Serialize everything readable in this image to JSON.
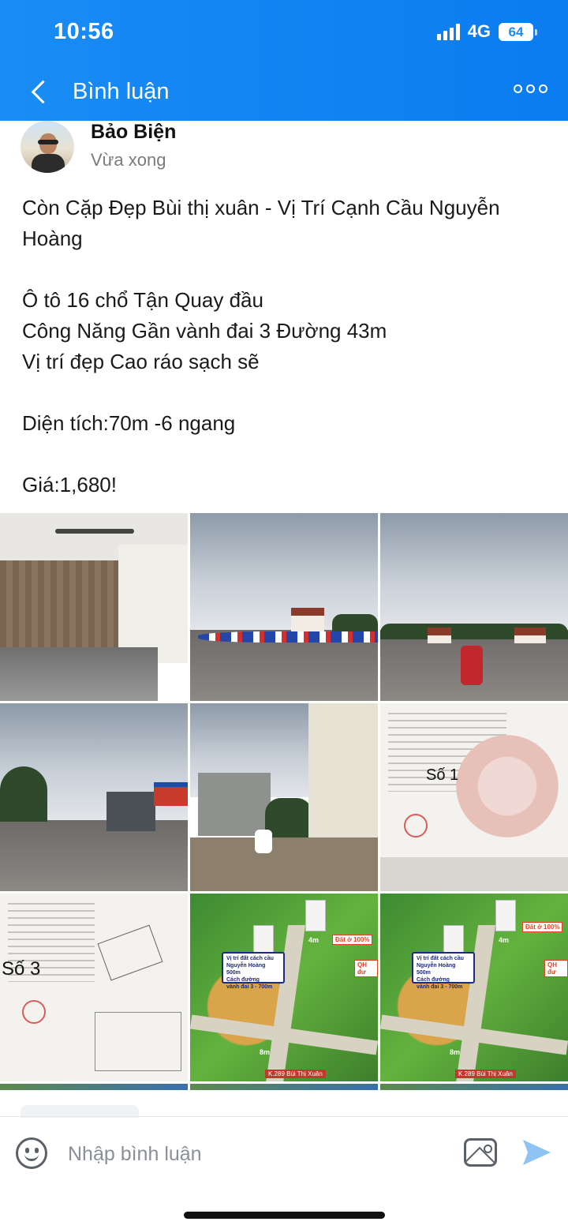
{
  "status_bar": {
    "time": "10:56",
    "network": "4G",
    "battery": "64"
  },
  "header": {
    "title": "Bình luận",
    "back_icon": "chevron-left-icon",
    "more_icon": "more-dots-icon"
  },
  "post": {
    "author": "Bảo Biện",
    "time": "Vừa xong",
    "text_lines": [
      "Còn Cặp Đẹp Bùi thị xuân - Vị Trí Cạnh Cầu Nguyễn",
      "Hoàng",
      "",
      "Ô tô 16 chổ Tận Quay đầu",
      "Công Năng Gần vành đai 3 Đường 43m",
      "Vị trí đẹp Cao ráo sạch sẽ",
      "",
      "Diện tích:70m -6 ngang",
      "",
      "Giá:1,680!"
    ],
    "image_labels": {
      "doc1": "Số 1",
      "doc3": "Số 3",
      "aerial_info": [
        "Vị trí đất cách cầu",
        "Nguyễn Hoàng 500m",
        "Cách đường",
        "vành đai 3 - 700m"
      ],
      "aerial_tag1": "Đất ở 100%",
      "aerial_tag2": "QH đư",
      "aerial_road": "K.289 Bùi Thị Xuân",
      "aerial_side": "4m",
      "aerial_bottom": "8m"
    }
  },
  "composer": {
    "placeholder": "Nhập bình luận",
    "emoji_icon": "emoji-icon",
    "image_icon": "image-icon",
    "send_icon": "send-icon"
  },
  "colors": {
    "header_blue": "#1a8cf5",
    "send_blue": "#8ec3f3"
  }
}
